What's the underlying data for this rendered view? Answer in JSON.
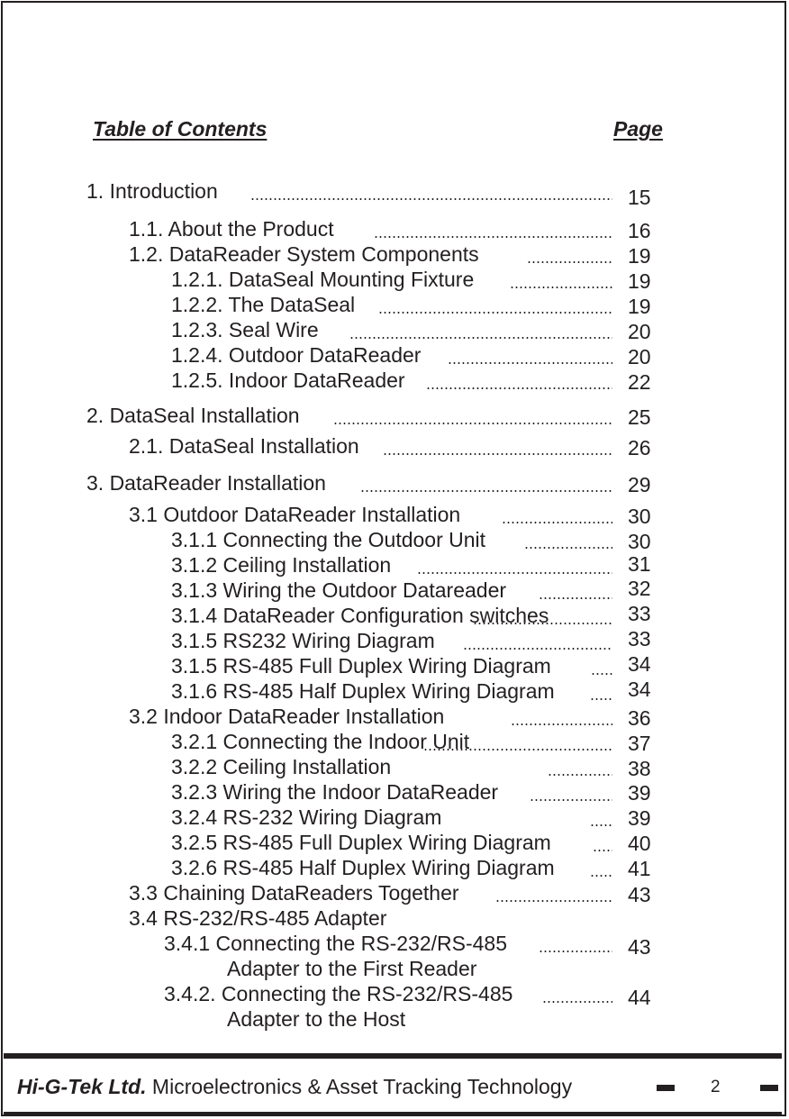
{
  "header": {
    "title": "Table of Contents",
    "page_label": "Page"
  },
  "entries": [
    {
      "text": "1.  Introduction",
      "page": "15"
    },
    {
      "text": "1.1. About the Product",
      "page": "16"
    },
    {
      "text": "1.2. DataReader System Components",
      "page": "19"
    },
    {
      "text": "1.2.1. DataSeal Mounting Fixture",
      "page": "19"
    },
    {
      "text": "1.2.2. The DataSeal",
      "page": "19"
    },
    {
      "text": "1.2.3. Seal Wire",
      "page": "20"
    },
    {
      "text": "1.2.4. Outdoor DataReader",
      "page": "20"
    },
    {
      "text": "1.2.5. Indoor DataReader",
      "page": "22"
    },
    {
      "text": "2.  DataSeal Installation",
      "page": "25"
    },
    {
      "text": "2.1. DataSeal Installation",
      "page": "26"
    },
    {
      "text": "3.  DataReader Installation",
      "page": "29"
    },
    {
      "text": "3.1  Outdoor DataReader Installation",
      "page": "30"
    },
    {
      "text": "3.1.1 Connecting the Outdoor Unit",
      "page": "30"
    },
    {
      "text": "3.1.2 Ceiling Installation",
      "page": "31"
    },
    {
      "text": "3.1.3 Wiring the Outdoor Datareader",
      "page": "32"
    },
    {
      "text": "3.1.4 DataReader Configuration switches",
      "page": "33"
    },
    {
      "text": "3.1.5 RS232 Wiring Diagram",
      "page": "33"
    },
    {
      "text": "3.1.5 RS-485 Full Duplex Wiring Diagram",
      "page": "34"
    },
    {
      "text": "3.1.6 RS-485 Half Duplex Wiring Diagram",
      "page": "34"
    },
    {
      "text": "3.2  Indoor DataReader Installation",
      "page": "36"
    },
    {
      "text": "3.2.1  Connecting the Indoor Unit",
      "page": "37"
    },
    {
      "text": "3.2.2 Ceiling Installation",
      "page": "38"
    },
    {
      "text": "3.2.3 Wiring the Indoor DataReader",
      "page": "39"
    },
    {
      "text": "3.2.4 RS-232 Wiring Diagram",
      "page": "39"
    },
    {
      "text": "3.2.5 RS-485 Full Duplex Wiring Diagram",
      "page": "40"
    },
    {
      "text": "3.2.6 RS-485 Half Duplex Wiring Diagram",
      "page": "41"
    },
    {
      "text": "3.3  Chaining DataReaders Together",
      "page": "43"
    },
    {
      "text": "3.4  RS-232/RS-485 Adapter",
      "page": ""
    },
    {
      "text": "3.4.1 Connecting the RS-232/RS-485",
      "page": "43"
    },
    {
      "text": "Adapter to the First Reader",
      "page": ""
    },
    {
      "text": "3.4.2. Connecting the RS-232/RS-485",
      "page": "44"
    },
    {
      "text": "Adapter to the Host",
      "page": ""
    }
  ],
  "footer": {
    "company": "Hi-G-Tek Ltd.",
    "tagline": "Microelectronics & Asset Tracking Technology",
    "page_number": "2"
  }
}
